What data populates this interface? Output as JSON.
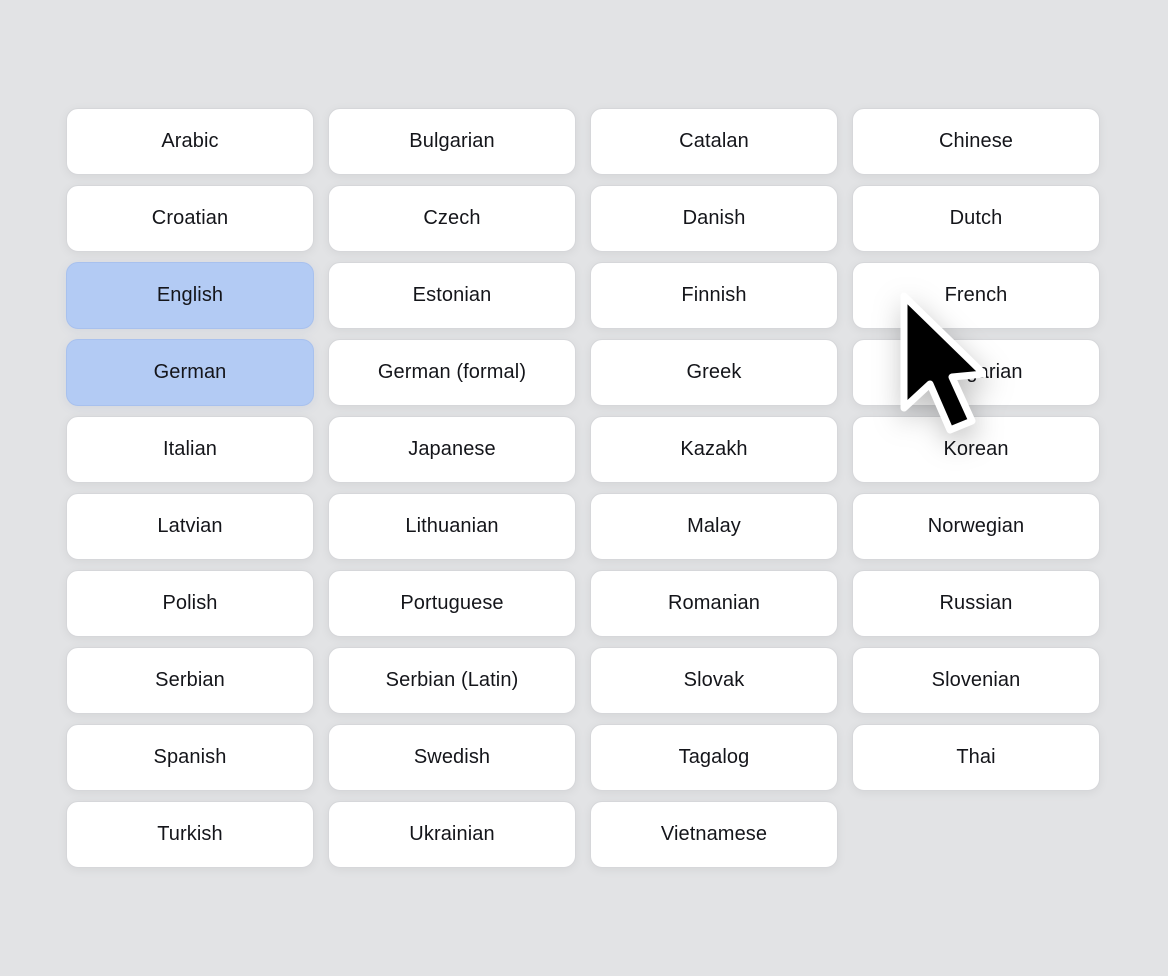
{
  "languages": [
    {
      "label": "Arabic",
      "selected": false
    },
    {
      "label": "Bulgarian",
      "selected": false
    },
    {
      "label": "Catalan",
      "selected": false
    },
    {
      "label": "Chinese",
      "selected": false
    },
    {
      "label": "Croatian",
      "selected": false
    },
    {
      "label": "Czech",
      "selected": false
    },
    {
      "label": "Danish",
      "selected": false
    },
    {
      "label": "Dutch",
      "selected": false
    },
    {
      "label": "English",
      "selected": true
    },
    {
      "label": "Estonian",
      "selected": false
    },
    {
      "label": "Finnish",
      "selected": false
    },
    {
      "label": "French",
      "selected": false
    },
    {
      "label": "German",
      "selected": true
    },
    {
      "label": "German (formal)",
      "selected": false
    },
    {
      "label": "Greek",
      "selected": false
    },
    {
      "label": "Hungarian",
      "selected": false
    },
    {
      "label": "Italian",
      "selected": false
    },
    {
      "label": "Japanese",
      "selected": false
    },
    {
      "label": "Kazakh",
      "selected": false
    },
    {
      "label": "Korean",
      "selected": false
    },
    {
      "label": "Latvian",
      "selected": false
    },
    {
      "label": "Lithuanian",
      "selected": false
    },
    {
      "label": "Malay",
      "selected": false
    },
    {
      "label": "Norwegian",
      "selected": false
    },
    {
      "label": "Polish",
      "selected": false
    },
    {
      "label": "Portuguese",
      "selected": false
    },
    {
      "label": "Romanian",
      "selected": false
    },
    {
      "label": "Russian",
      "selected": false
    },
    {
      "label": "Serbian",
      "selected": false
    },
    {
      "label": "Serbian (Latin)",
      "selected": false
    },
    {
      "label": "Slovak",
      "selected": false
    },
    {
      "label": "Slovenian",
      "selected": false
    },
    {
      "label": "Spanish",
      "selected": false
    },
    {
      "label": "Swedish",
      "selected": false
    },
    {
      "label": "Tagalog",
      "selected": false
    },
    {
      "label": "Thai",
      "selected": false
    },
    {
      "label": "Turkish",
      "selected": false
    },
    {
      "label": "Ukrainian",
      "selected": false
    },
    {
      "label": "Vietnamese",
      "selected": false
    }
  ],
  "colors": {
    "background": "#e2e3e5",
    "button": "#ffffff",
    "selected": "#b3cbf4",
    "text": "#14151a"
  },
  "cursor": {
    "icon": "mouse-pointer-icon"
  }
}
